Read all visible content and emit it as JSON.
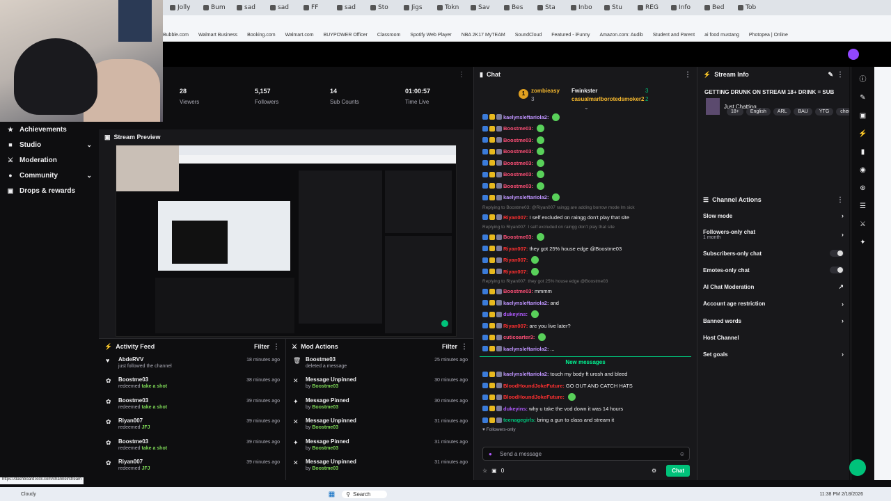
{
  "browser": {
    "tabs": [
      "Jolly",
      "Bum",
      "sad",
      "sad",
      "FF",
      "sad",
      "Sto",
      "Jigs",
      "Tokn",
      "Sav",
      "Bes",
      "Sta",
      "Inbo",
      "Stu",
      "REG",
      "Info",
      "Bed",
      "Tob"
    ],
    "bookmarks": [
      "Bubble.com",
      "Walmart Business",
      "Booking.com",
      "Walmart.com",
      "BUYPOWER Officer",
      "Classroom",
      "Spotify Web Player",
      "NBA 2K17 MyTEAM",
      "SoundCloud",
      "Featured - iFunny",
      "Amazon.com: Audib",
      "Student and Parent",
      "ai food mustang",
      "Photopea | Online"
    ]
  },
  "sidebar": {
    "items": [
      {
        "label": "Achievements",
        "icon": "trophy-icon",
        "chevron": false
      },
      {
        "label": "Studio",
        "icon": "studio-icon",
        "chevron": true
      },
      {
        "label": "Moderation",
        "icon": "sword-icon",
        "chevron": false
      },
      {
        "label": "Community",
        "icon": "people-icon",
        "chevron": true
      },
      {
        "label": "Drops & rewards",
        "icon": "gift-icon",
        "chevron": false
      }
    ]
  },
  "stats": {
    "viewers": {
      "value": "28",
      "label": "Viewers"
    },
    "followers": {
      "value": "5,157",
      "label": "Followers"
    },
    "subs": {
      "value": "14",
      "label": "Sub Counts"
    },
    "time": {
      "value": "01:00:57",
      "label": "Time Live"
    }
  },
  "preview": {
    "title": "Stream Preview"
  },
  "activity": {
    "title": "Activity Feed",
    "filter": "Filter",
    "rows": [
      {
        "name": "AbdeRVV",
        "action": "just followed the channel",
        "reward": "",
        "time": "18 minutes ago"
      },
      {
        "name": "Boostme03",
        "action": "redeemed",
        "reward": "take a shot",
        "time": "38 minutes ago"
      },
      {
        "name": "Boostme03",
        "action": "redeemed",
        "reward": "take a shot",
        "time": "39 minutes ago"
      },
      {
        "name": "Riyan007",
        "action": "redeemed",
        "reward": "JFJ",
        "time": "39 minutes ago"
      },
      {
        "name": "Boostme03",
        "action": "redeemed",
        "reward": "take a shot",
        "time": "39 minutes ago"
      },
      {
        "name": "Riyan007",
        "action": "redeemed",
        "reward": "JFJ",
        "time": "39 minutes ago"
      }
    ]
  },
  "modactions": {
    "title": "Mod Actions",
    "filter": "Filter",
    "rows": [
      {
        "name": "Boostme03",
        "sub": "deleted a message",
        "by": "",
        "time": "25 minutes ago"
      },
      {
        "name": "Message Unpinned",
        "sub": "by",
        "by": "Boostme03",
        "time": "30 minutes ago"
      },
      {
        "name": "Message Pinned",
        "sub": "by",
        "by": "Boostme03",
        "time": "30 minutes ago"
      },
      {
        "name": "Message Unpinned",
        "sub": "by",
        "by": "Boostme03",
        "time": "31 minutes ago"
      },
      {
        "name": "Message Pinned",
        "sub": "by",
        "by": "Boostme03",
        "time": "31 minutes ago"
      },
      {
        "name": "Message Unpinned",
        "sub": "by",
        "by": "Boostme03",
        "time": "31 minutes ago"
      }
    ]
  },
  "chat": {
    "title": "Chat",
    "leaderboard": {
      "first": "zombieasy",
      "first_rank": "1",
      "first_score": "3",
      "second": "Fwinkster",
      "second_score": "3",
      "third": "casualmarlborotedsmoker2",
      "third_score": "2"
    },
    "messages": [
      {
        "user": "kaelynsleftariola2:",
        "text": "",
        "color": "#bf94ff",
        "type": "msg"
      },
      {
        "user": "Boostme03:",
        "text": "",
        "color": "#ff4f77",
        "type": "msg"
      },
      {
        "user": "Boostme03:",
        "text": "",
        "color": "#ff4f77",
        "type": "msg"
      },
      {
        "user": "Boostme03:",
        "text": "",
        "color": "#ff4f77",
        "type": "msg"
      },
      {
        "user": "Boostme03:",
        "text": "",
        "color": "#ff4f77",
        "type": "msg"
      },
      {
        "user": "Boostme03:",
        "text": "",
        "color": "#ff4f77",
        "type": "msg"
      },
      {
        "user": "Boostme03:",
        "text": "",
        "color": "#ff4f77",
        "type": "msg"
      },
      {
        "user": "kaelynsleftariola2:",
        "text": "",
        "color": "#bf94ff",
        "type": "msg"
      },
      {
        "user": "",
        "text": "Replying to Boostme03: @Riyan007 raingg are adding borrow mode lm sick",
        "color": "#777",
        "type": "reply"
      },
      {
        "user": "Riyan007:",
        "text": "I self excluded on raingg don't play that site",
        "color": "#ff3030",
        "type": "msg"
      },
      {
        "user": "",
        "text": "Replying to Riyan007: I self excluded on raingg don't play that site",
        "color": "#777",
        "type": "reply"
      },
      {
        "user": "Boostme03:",
        "text": "",
        "color": "#ff4f77",
        "type": "msg"
      },
      {
        "user": "Riyan007:",
        "text": "they got 25% house edge @Boostme03",
        "color": "#ff3030",
        "type": "msg"
      },
      {
        "user": "Riyan007:",
        "text": "",
        "color": "#ff3030",
        "type": "msg"
      },
      {
        "user": "Riyan007:",
        "text": "",
        "color": "#ff3030",
        "type": "msg"
      },
      {
        "user": "",
        "text": "Replying to Riyan007: they got 25% house edge @Boostme03",
        "color": "#777",
        "type": "reply"
      },
      {
        "user": "Boostme03:",
        "text": "mmmm",
        "color": "#ff4f77",
        "type": "msg"
      },
      {
        "user": "kaelynsleftariola2:",
        "text": "and",
        "color": "#bf94ff",
        "type": "msg"
      },
      {
        "user": "dukeyins:",
        "text": "",
        "color": "#b15aff",
        "type": "msg"
      },
      {
        "user": "Riyan007:",
        "text": "are you live later?",
        "color": "#ff3030",
        "type": "msg"
      },
      {
        "user": "cuticoarter3:",
        "text": "",
        "color": "#ff4f77",
        "type": "msg"
      },
      {
        "user": "kaelynsleftariola2:",
        "text": "...",
        "color": "#bf94ff",
        "type": "msg"
      }
    ],
    "new_messages": "New messages",
    "messages_after": [
      {
        "user": "kaelynsleftariola2:",
        "text": "touch my body ft urosh and bleed",
        "color": "#bf94ff"
      },
      {
        "user": "BloodHoundJokeFuture:",
        "text": "GO OUT AND CATCH HATS",
        "color": "#ff3030"
      },
      {
        "user": "BloodHoundJokeFuture:",
        "text": "",
        "color": "#ff3030"
      },
      {
        "user": "dukeyins:",
        "text": "why u take the vod down it was 14 hours",
        "color": "#b15aff"
      },
      {
        "user": "teenagegirls:",
        "text": "bring a gun to class and stream it",
        "color": "#00c27a"
      }
    ],
    "followers_only": "Followers-only",
    "placeholder": "Send a message",
    "points": "0",
    "send_label": "Chat"
  },
  "streaminfo": {
    "title": "Stream Info",
    "stream_title": "GETTING DRUNK ON STREAM 18+ DRINK = SUB",
    "category": "Just Chatting",
    "tags": [
      "18+",
      "English",
      "ARL",
      "BAU",
      "YTG",
      "chee"
    ]
  },
  "channelactions": {
    "title": "Channel Actions",
    "items": [
      {
        "label": "Slow mode",
        "control": "chevron"
      },
      {
        "label": "Followers-only chat",
        "sub": "1 month",
        "control": "chevron"
      },
      {
        "label": "Subscribers-only chat",
        "control": "toggle"
      },
      {
        "label": "Emotes-only chat",
        "control": "toggle"
      },
      {
        "label": "AI Chat Moderation",
        "control": "link"
      },
      {
        "label": "Account age restriction",
        "control": "chevron"
      },
      {
        "label": "Banned words",
        "control": "chevron"
      },
      {
        "label": "Host Channel",
        "control": "none"
      },
      {
        "label": "Set goals",
        "control": "chevron"
      }
    ]
  },
  "taskbar": {
    "search": "Search",
    "time": "11:38 PM",
    "date": "2/18/2026",
    "weather": "Cloudy"
  },
  "statusbar_url": "https://dashboard.kick.com/channel/stream"
}
